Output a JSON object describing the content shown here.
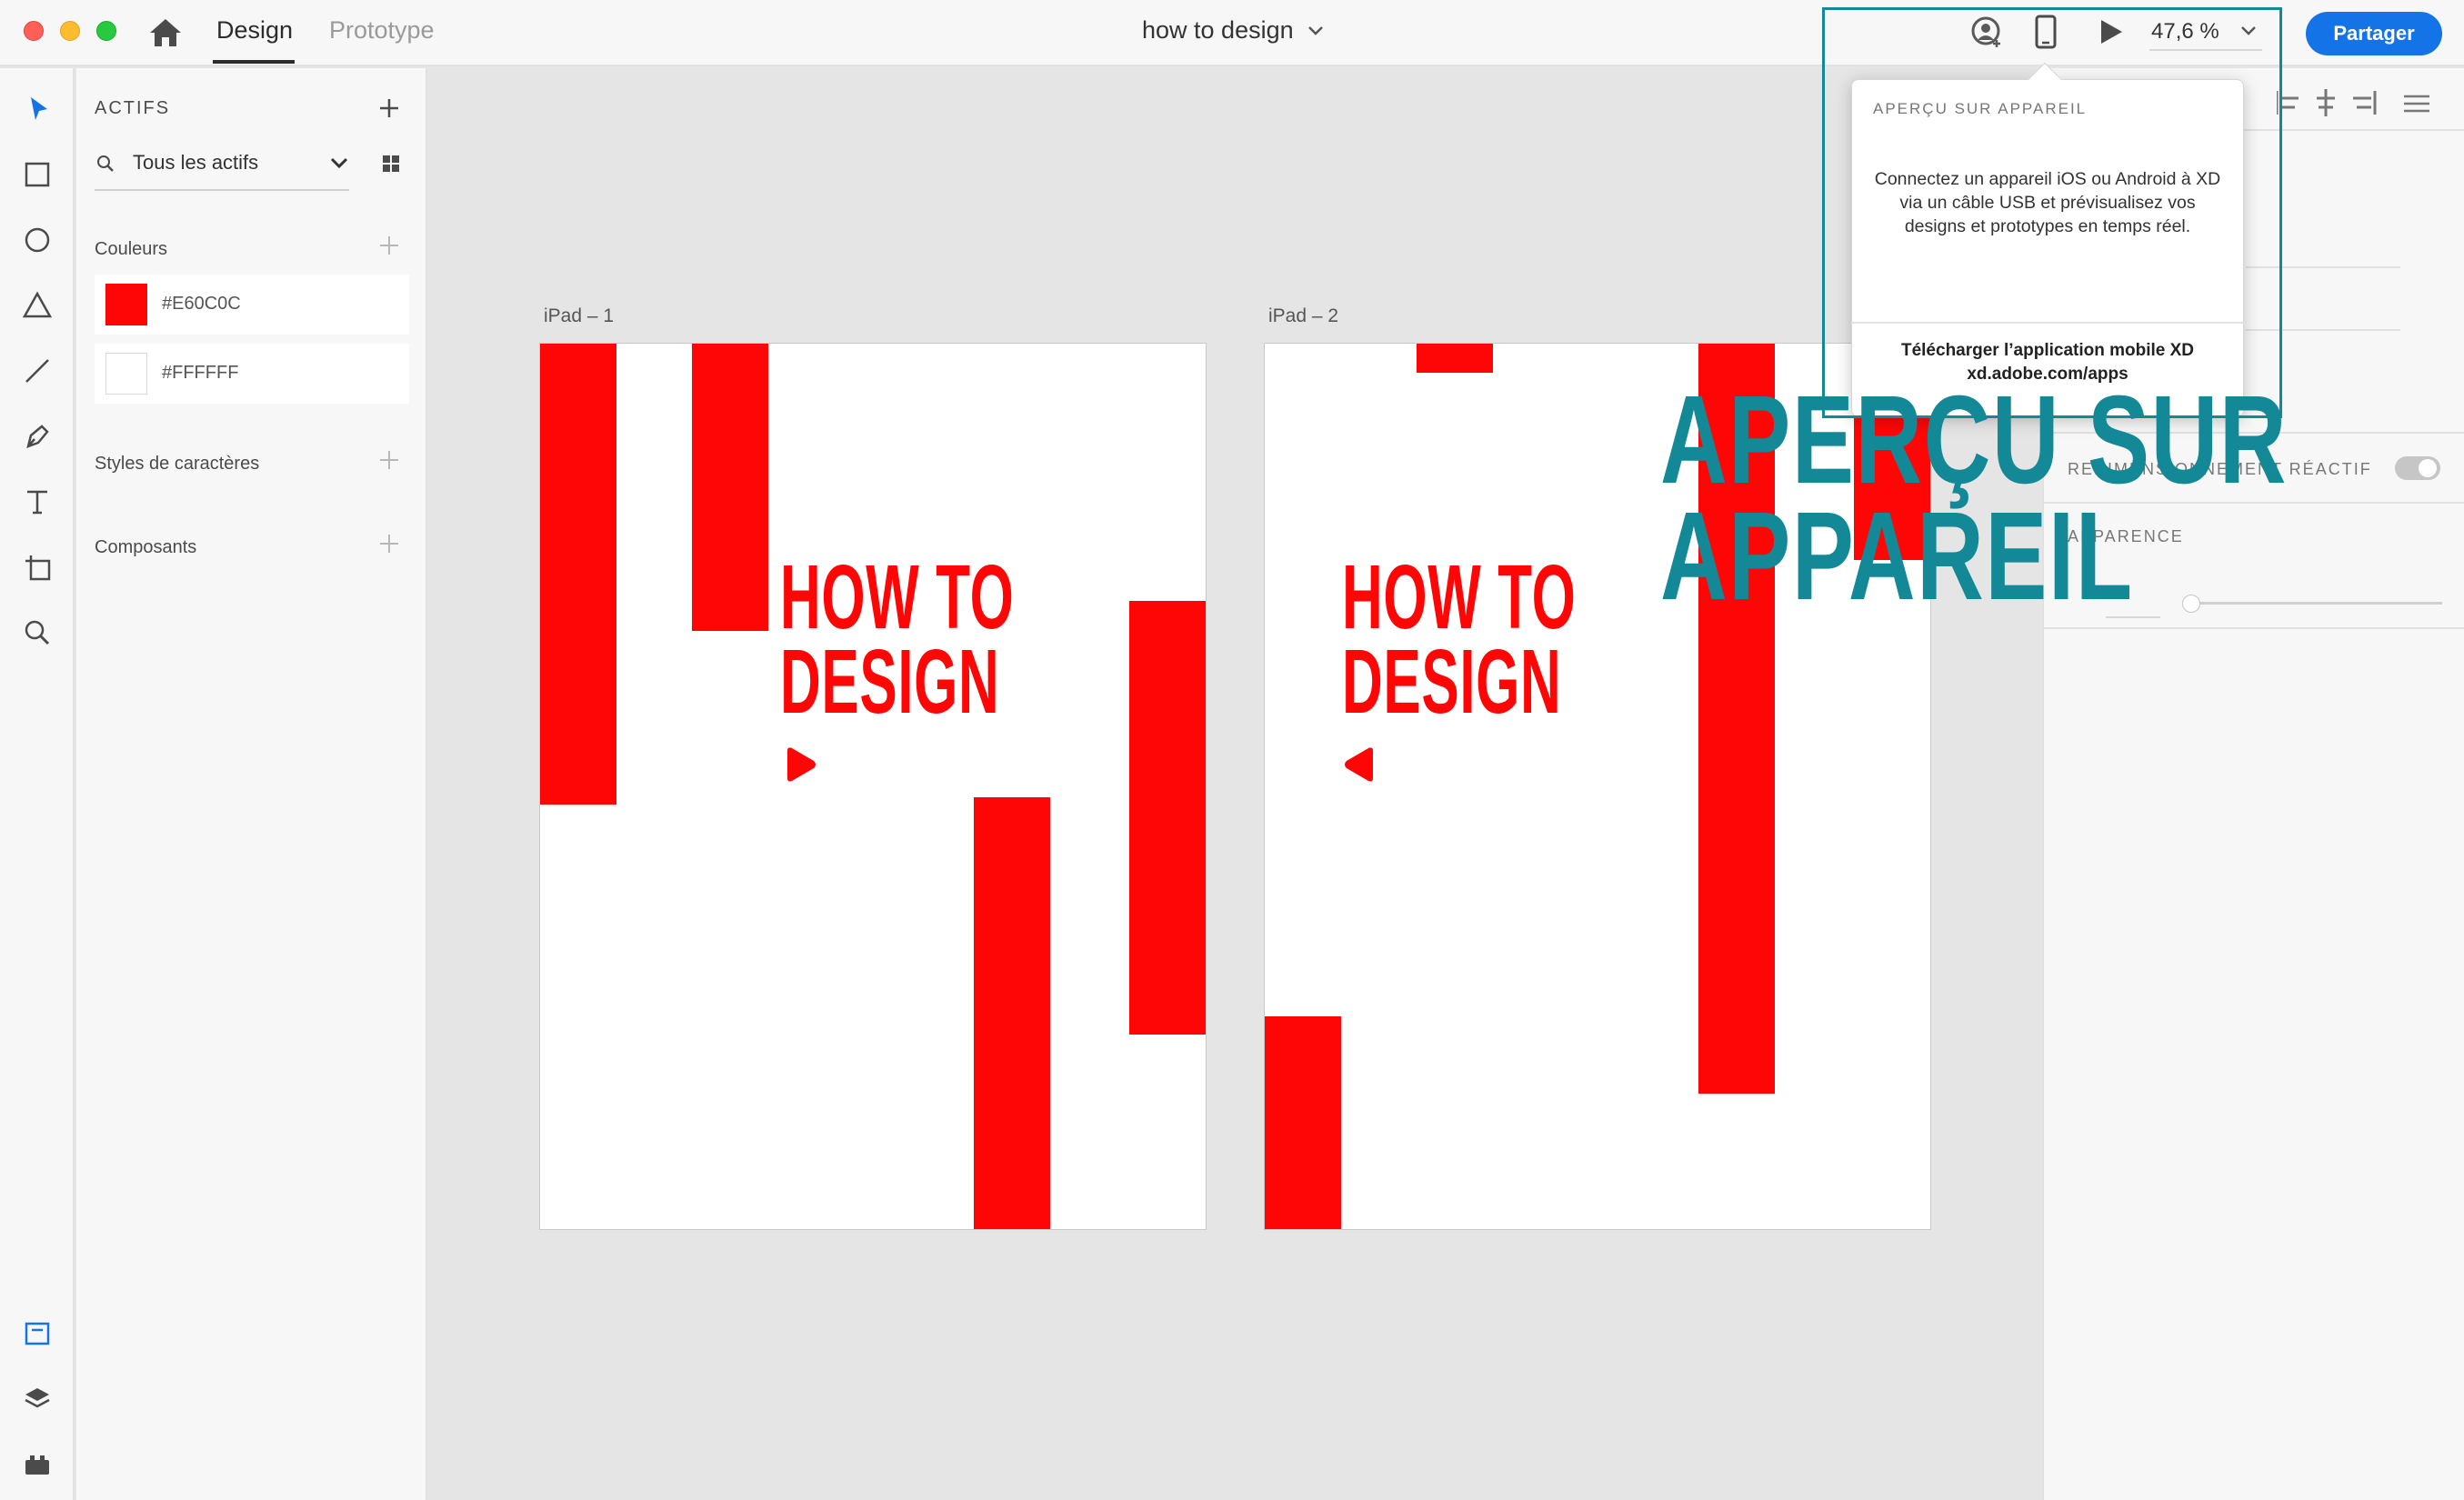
{
  "window": {
    "tabs": [
      {
        "label": "Design",
        "active": true
      },
      {
        "label": "Prototype",
        "active": false
      }
    ],
    "document_title": "how to design",
    "zoom": "47,6 %",
    "share_label": "Partager"
  },
  "assets": {
    "title": "ACTIFS",
    "filter": "Tous les actifs",
    "colors_label": "Couleurs",
    "colors": [
      {
        "label": "#E60C0C",
        "hex": "#ff0606"
      },
      {
        "label": "#FFFFFF",
        "hex": "#ffffff"
      }
    ],
    "char_styles_label": "Styles de caractères",
    "components_label": "Composants"
  },
  "canvas": {
    "artboards": [
      {
        "label": "iPad – 1",
        "headline_line1": "HOW TO",
        "headline_line2": "DESIGN",
        "arrow": "play-right-icon"
      },
      {
        "label": "iPad – 2",
        "headline_line1": "HOW TO",
        "headline_line2": "DESIGN",
        "arrow": "play-left-icon"
      }
    ],
    "accent_color": "#ff0606"
  },
  "properties": {
    "responsive_label": "REDIMENSIONNEMENT RÉACTIF",
    "appearance_label": "APPARENCE"
  },
  "popover": {
    "title": "APERÇU SUR APPAREIL",
    "body": "Connectez un appareil iOS ou Android à XD via un câble USB et prévisualisez vos designs et prototypes en temps réel.",
    "download": "Télécharger l’application mobile XD",
    "url": "xd.adobe.com/apps"
  },
  "callout": {
    "line1": "APERÇU SUR",
    "line2": "APPAREIL",
    "color": "#138896"
  }
}
